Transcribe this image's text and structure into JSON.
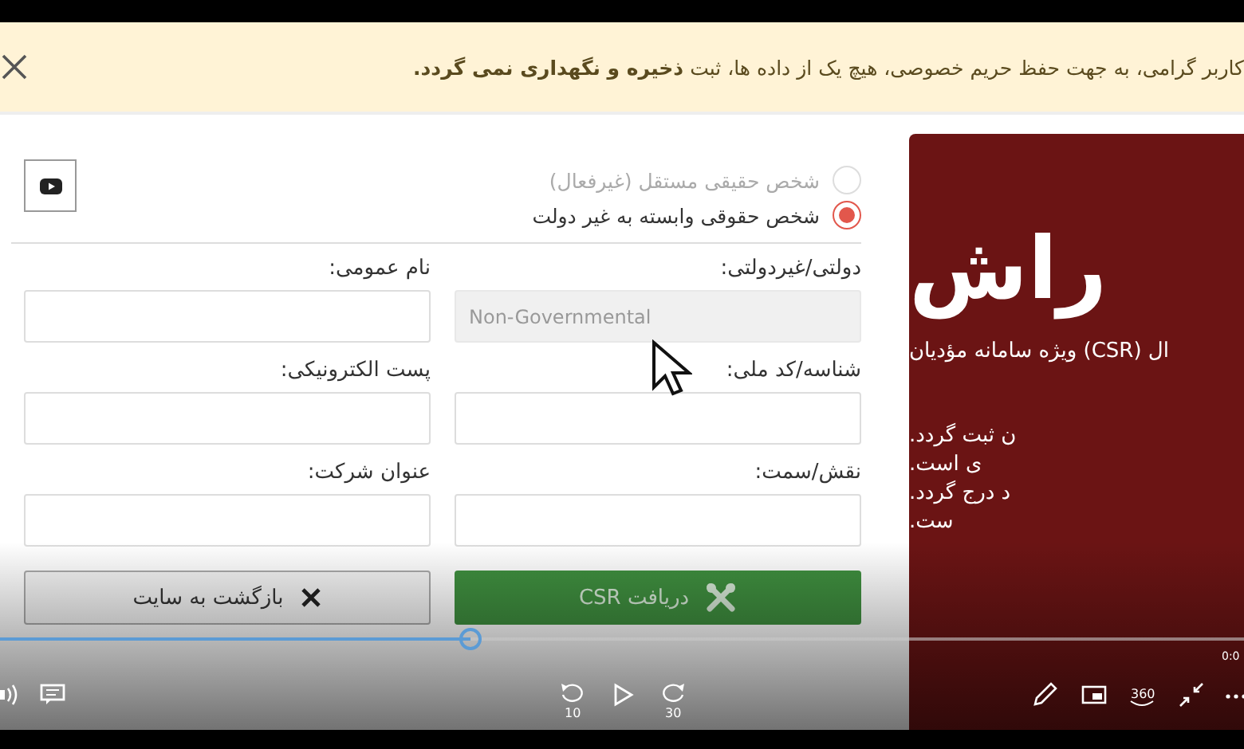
{
  "notice": {
    "text": "کاربر گرامی، به جهت حفظ حریم خصوصی، هیچ یک از داده ها، ثبت **ذخیره و نگهداری نمی گردد.**"
  },
  "form": {
    "person_types": [
      {
        "label": "شخص حقیقی مستقل (غیرفعال)",
        "selected": false,
        "disabled": true
      },
      {
        "label": "شخص حقوقی وابسته به غیر دولت",
        "selected": true,
        "disabled": false
      }
    ],
    "fields": [
      {
        "label": "دولتی/غیردولتی:",
        "value": "Non-Governmental",
        "readonly": true
      },
      {
        "label": "نام عمومی:",
        "readonly": false
      },
      {
        "label": "شناسه/کد ملی:",
        "readonly": false
      },
      {
        "label": "پست الکترونیکی:",
        "readonly": false
      },
      {
        "label": "نقش/سمت:",
        "readonly": false
      },
      {
        "label": "عنوان شرکت:",
        "readonly": false
      }
    ],
    "buttons": [
      {
        "kind": "submit",
        "label": "دریافت CSR"
      },
      {
        "kind": "back",
        "label": "بازگشت به سایت"
      }
    ]
  },
  "side_panel": {
    "logo": "راش",
    "subtitle": "ال (CSR) ویژه سامانه مؤدیان",
    "lines": [
      "ن ثبت گردد.",
      "ی است.",
      "د درج گردد.",
      "ست."
    ]
  },
  "player": {
    "progress": {
      "level": 0.378
    },
    "time": "0:0",
    "rewind": "10",
    "forward": "30",
    "vr": "360"
  }
}
